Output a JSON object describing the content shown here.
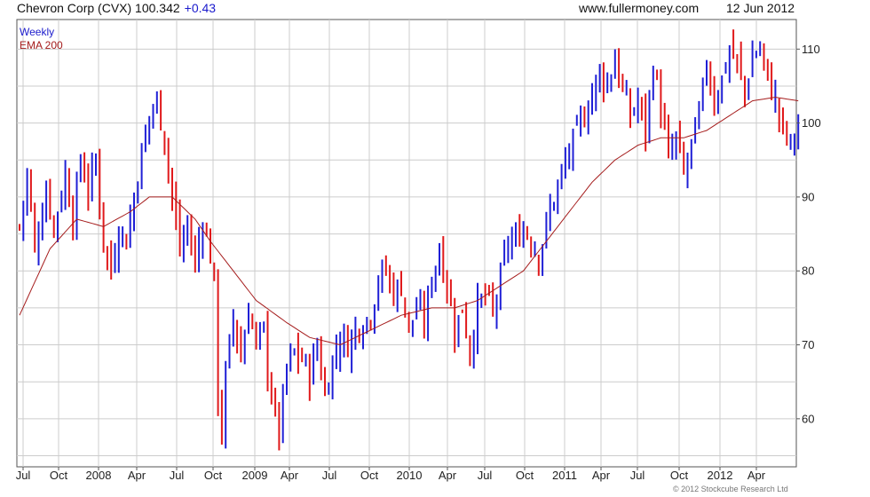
{
  "header": {
    "title": "Chevron Corp (CVX) 100.342",
    "change": "+0.43",
    "site": "www.fullermoney.com",
    "date": "12 Jun 2012"
  },
  "copyright": "© 2012 Stockcube Research Ltd",
  "colors": {
    "up": "#1f1fd6",
    "down": "#e0191b",
    "ema": "#a51c1c",
    "grid": "#cccccc",
    "legend_weekly": "#1a1acc",
    "legend_ema": "#a51c1c"
  },
  "chart_data": {
    "type": "candlestick",
    "title": "Chevron Corp (CVX) 100.342",
    "x_tick_labels": [
      "Jul",
      "Oct",
      "2008",
      "Apr",
      "Jul",
      "Oct",
      "2009",
      "Apr",
      "Jul",
      "Oct",
      "2010",
      "Apr",
      "Jul",
      "Oct",
      "2011",
      "Apr",
      "Jul",
      "Oct",
      "2012",
      "Apr"
    ],
    "y_ticks": [
      60,
      70,
      80,
      90,
      100,
      110
    ],
    "ylim": [
      53.5,
      114
    ],
    "grid": true,
    "legend": {
      "position": "top-left",
      "entries": [
        "Weekly",
        "EMA 200"
      ]
    },
    "close_anchors": [
      [
        0,
        86
      ],
      [
        2,
        93
      ],
      [
        4,
        83
      ],
      [
        7,
        91
      ],
      [
        9,
        86
      ],
      [
        12,
        93
      ],
      [
        14,
        87
      ],
      [
        16,
        95
      ],
      [
        18,
        91
      ],
      [
        20,
        95
      ],
      [
        22,
        84
      ],
      [
        24,
        80
      ],
      [
        26,
        86
      ],
      [
        28,
        84
      ],
      [
        30,
        90
      ],
      [
        32,
        96
      ],
      [
        34,
        101
      ],
      [
        36,
        103
      ],
      [
        38,
        98
      ],
      [
        40,
        90
      ],
      [
        42,
        83
      ],
      [
        44,
        86
      ],
      [
        46,
        81
      ],
      [
        48,
        87
      ],
      [
        50,
        82
      ],
      [
        51,
        78
      ],
      [
        52,
        63
      ],
      [
        53,
        58
      ],
      [
        54,
        66
      ],
      [
        56,
        74
      ],
      [
        58,
        68
      ],
      [
        60,
        75
      ],
      [
        62,
        70
      ],
      [
        64,
        72
      ],
      [
        65,
        67
      ],
      [
        66,
        63
      ],
      [
        68,
        58
      ],
      [
        70,
        67
      ],
      [
        72,
        69
      ],
      [
        74,
        68
      ],
      [
        76,
        66
      ],
      [
        78,
        70
      ],
      [
        80,
        63
      ],
      [
        82,
        68
      ],
      [
        84,
        71
      ],
      [
        86,
        70
      ],
      [
        88,
        72
      ],
      [
        90,
        73
      ],
      [
        92,
        74
      ],
      [
        94,
        79
      ],
      [
        96,
        80
      ],
      [
        98,
        77
      ],
      [
        100,
        78
      ],
      [
        102,
        72
      ],
      [
        104,
        75
      ],
      [
        106,
        73
      ],
      [
        108,
        79
      ],
      [
        110,
        83
      ],
      [
        112,
        78
      ],
      [
        114,
        72
      ],
      [
        116,
        75
      ],
      [
        118,
        69
      ],
      [
        120,
        75
      ],
      [
        122,
        77
      ],
      [
        124,
        74
      ],
      [
        126,
        79
      ],
      [
        128,
        84
      ],
      [
        130,
        84
      ],
      [
        132,
        86
      ],
      [
        134,
        84
      ],
      [
        136,
        82
      ],
      [
        138,
        86
      ],
      [
        140,
        90
      ],
      [
        142,
        93
      ],
      [
        144,
        96
      ],
      [
        146,
        99
      ],
      [
        148,
        101
      ],
      [
        150,
        104
      ],
      [
        152,
        107
      ],
      [
        154,
        105
      ],
      [
        156,
        109
      ],
      [
        158,
        104
      ],
      [
        160,
        101
      ],
      [
        162,
        103
      ],
      [
        164,
        99
      ],
      [
        166,
        108
      ],
      [
        168,
        102
      ],
      [
        170,
        95
      ],
      [
        172,
        98
      ],
      [
        174,
        93
      ],
      [
        176,
        97
      ],
      [
        178,
        101
      ],
      [
        180,
        108
      ],
      [
        182,
        103
      ],
      [
        184,
        106
      ],
      [
        186,
        110
      ],
      [
        188,
        108
      ],
      [
        190,
        104
      ],
      [
        192,
        109
      ],
      [
        194,
        110
      ],
      [
        196,
        106
      ],
      [
        198,
        103
      ],
      [
        200,
        99
      ],
      [
        202,
        97
      ],
      [
        204,
        100
      ]
    ],
    "ema_anchors": [
      [
        0,
        74
      ],
      [
        8,
        83
      ],
      [
        15,
        87
      ],
      [
        22,
        86
      ],
      [
        29,
        88
      ],
      [
        34,
        90
      ],
      [
        40,
        90
      ],
      [
        46,
        87
      ],
      [
        50,
        84
      ],
      [
        56,
        80
      ],
      [
        62,
        76
      ],
      [
        70,
        73
      ],
      [
        76,
        71
      ],
      [
        84,
        70
      ],
      [
        92,
        72
      ],
      [
        100,
        74
      ],
      [
        108,
        75
      ],
      [
        114,
        75
      ],
      [
        120,
        76
      ],
      [
        126,
        78
      ],
      [
        132,
        80
      ],
      [
        138,
        84
      ],
      [
        144,
        88
      ],
      [
        150,
        92
      ],
      [
        156,
        95
      ],
      [
        162,
        97
      ],
      [
        168,
        98
      ],
      [
        174,
        98
      ],
      [
        180,
        99
      ],
      [
        186,
        101
      ],
      [
        192,
        103
      ],
      [
        198,
        103.5
      ],
      [
        204,
        103
      ]
    ]
  }
}
